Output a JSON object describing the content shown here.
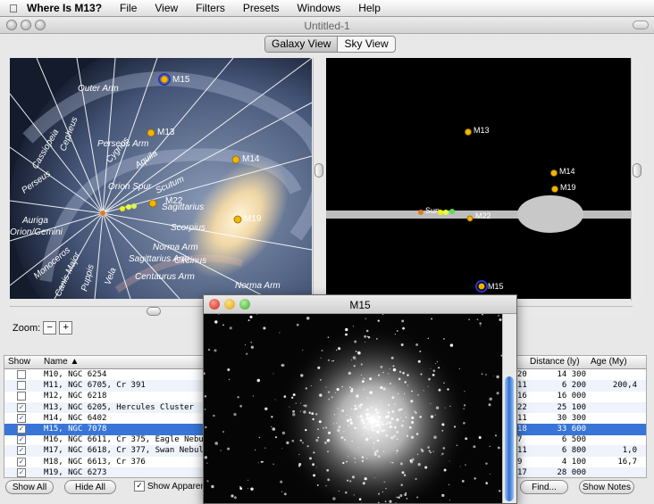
{
  "menubar": {
    "app": "Where Is M13?",
    "items": [
      "File",
      "View",
      "Filters",
      "Presets",
      "Windows",
      "Help"
    ]
  },
  "window": {
    "title": "Untitled-1"
  },
  "view_tabs": {
    "galaxy": "Galaxy View",
    "sky": "Sky View"
  },
  "galaxy": {
    "labels": [
      "Outer Arm",
      "Perseus Arm",
      "Cassiopeia",
      "Cepheus",
      "Perseus",
      "Auriga",
      "Orion Spur",
      "Cygnus",
      "Aquila",
      "Sagittarius",
      "Scorpius",
      "Norma Arm",
      "Sagittarius Arm",
      "Circinus",
      "Centaurus Arm",
      "Norma Arm",
      "Vela",
      "Puppis",
      "Canis Major",
      "Monoceros",
      "Orion/Gemini",
      "Scutum"
    ],
    "markers": [
      "M15",
      "M13",
      "M14",
      "M22",
      "M19",
      "Sun"
    ]
  },
  "sky": {
    "markers": [
      "M13",
      "M14",
      "M19",
      "Sun",
      "M22",
      "M15"
    ]
  },
  "zoom": {
    "label": "Zoom:",
    "minus": "−",
    "plus": "+"
  },
  "table": {
    "headers": {
      "show": "Show",
      "name": "Name",
      "distance": "Distance (ly)",
      "age": "Age (My)"
    },
    "rows": [
      {
        "checked": false,
        "name": "M10, NGC 6254",
        "col": "20",
        "distance": "14 300",
        "age": ""
      },
      {
        "checked": false,
        "name": "M11, NGC 6705, Cr 391",
        "col": "11",
        "distance": "6 200",
        "age": "200,4"
      },
      {
        "checked": false,
        "name": "M12, NGC 6218",
        "col": "16",
        "distance": "16 000",
        "age": ""
      },
      {
        "checked": true,
        "name": "M13, NGC 6205, Hercules Cluster",
        "col": "22",
        "distance": "25 100",
        "age": ""
      },
      {
        "checked": true,
        "name": "M14, NGC 6402",
        "col": "11",
        "distance": "30 300",
        "age": ""
      },
      {
        "checked": true,
        "name": "M15, NGC 7078",
        "col": "18",
        "distance": "33 600",
        "age": "",
        "selected": true
      },
      {
        "checked": true,
        "name": "M16, NGC 6611, Cr 375, Eagle Nebula",
        "col": "7",
        "distance": "6 500",
        "age": ""
      },
      {
        "checked": true,
        "name": "M17, NGC 6618, Cr 377, Swan Nebula",
        "col": "11",
        "distance": "6 800",
        "age": "1,0"
      },
      {
        "checked": true,
        "name": "M18, NGC 6613, Cr 376",
        "col": "9",
        "distance": "4 100",
        "age": "16,7"
      },
      {
        "checked": true,
        "name": "M19, NGC 6273",
        "col": "17",
        "distance": "28 000",
        "age": ""
      }
    ]
  },
  "buttons": {
    "show_all": "Show All",
    "hide_all": "Hide All",
    "show_apparent": "Show Apparent",
    "find": "Find...",
    "show_notes": "Show Notes"
  },
  "popup": {
    "title": "M15"
  },
  "colors": {
    "selection": "#3875d7",
    "marker": "#f4b400",
    "plane": "#bdbdbd"
  }
}
